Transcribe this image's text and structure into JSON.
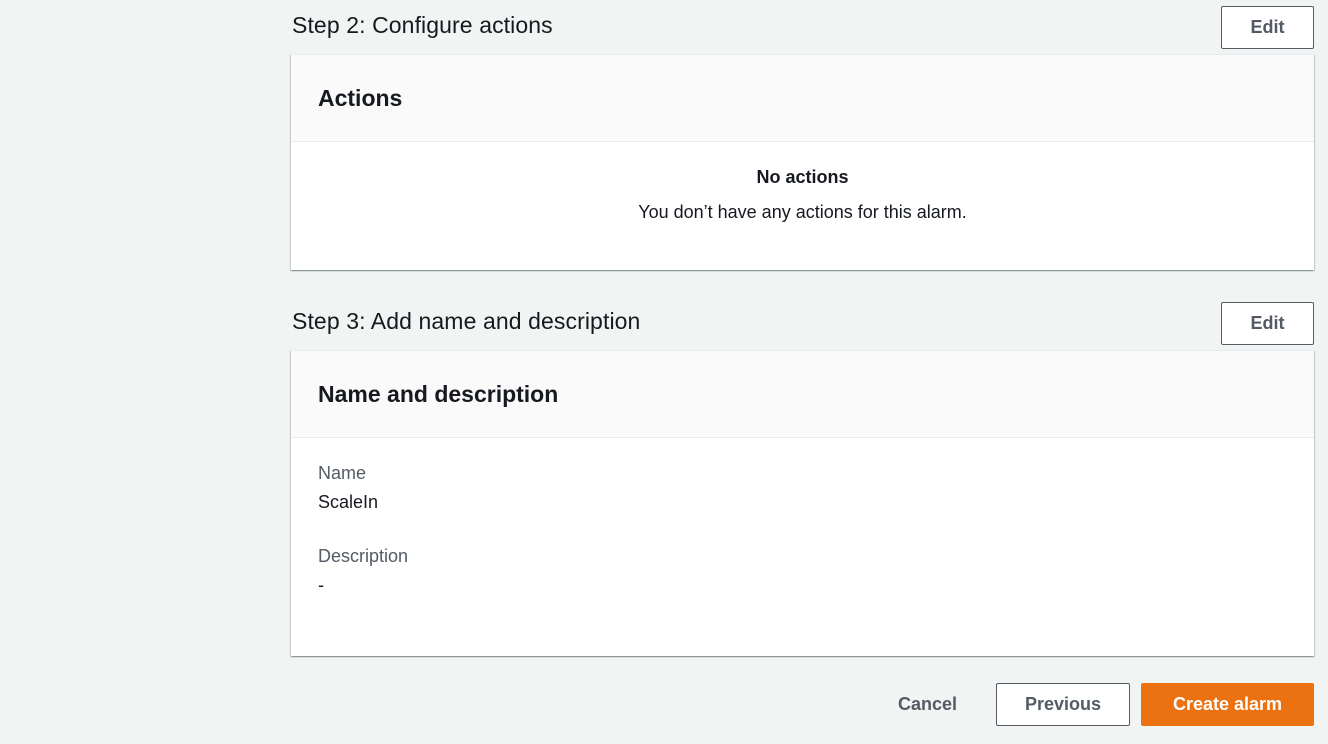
{
  "step2": {
    "title": "Step 2: Configure actions",
    "edit_label": "Edit",
    "panel_title": "Actions",
    "empty_title": "No actions",
    "empty_desc": "You don’t have any actions for this alarm."
  },
  "step3": {
    "title": "Step 3: Add name and description",
    "edit_label": "Edit",
    "panel_title": "Name and description",
    "fields": [
      {
        "label": "Name",
        "value": "ScaleIn"
      },
      {
        "label": "Description",
        "value": "-"
      }
    ]
  },
  "footer": {
    "cancel_label": "Cancel",
    "previous_label": "Previous",
    "create_label": "Create alarm"
  },
  "colors": {
    "primary": "#ec7211",
    "background": "#f2f3f3",
    "secondary_text": "#545b64"
  }
}
